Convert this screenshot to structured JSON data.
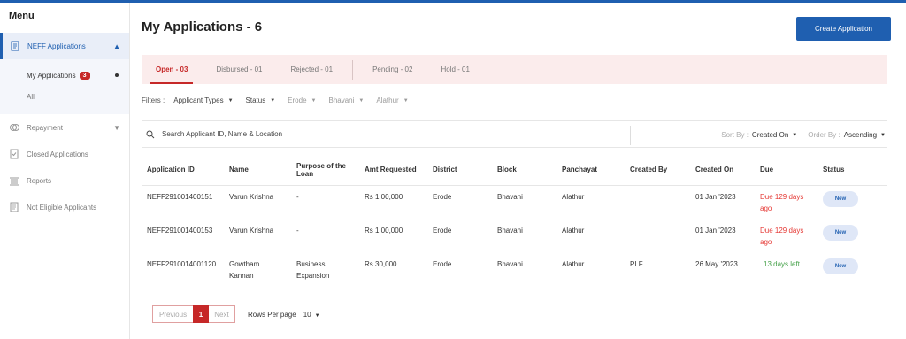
{
  "sidebar": {
    "menu_title": "Menu",
    "main_item": {
      "label": "NEFF Applications",
      "icon": "document-icon"
    },
    "sub_items": [
      {
        "label": "My Applications",
        "badge": "3"
      },
      {
        "label": "All"
      }
    ],
    "items": [
      {
        "label": "Repayment",
        "icon": "repayment-icon"
      },
      {
        "label": "Closed Applications",
        "icon": "checklist-icon"
      },
      {
        "label": "Reports",
        "icon": "bank-icon"
      },
      {
        "label": "Not Eligible Applicants",
        "icon": "document-icon"
      }
    ]
  },
  "header": {
    "title": "My Applications - 6",
    "create_button": "Create Application"
  },
  "tabs": [
    {
      "label": "Open - 03"
    },
    {
      "label": "Disbursed - 01"
    },
    {
      "label": "Rejected - 01"
    },
    {
      "label": "Pending - 02"
    },
    {
      "label": "Hold - 01"
    }
  ],
  "filters": {
    "label": "Filters :",
    "items": [
      {
        "label": "Applicant Types"
      },
      {
        "label": "Status"
      },
      {
        "label": "Erode"
      },
      {
        "label": "Bhavani"
      },
      {
        "label": "Alathur"
      }
    ]
  },
  "search": {
    "placeholder": "Search Applicant ID, Name & Location"
  },
  "sort": {
    "sort_by_label": "Sort By :",
    "sort_by_value": "Created On",
    "order_by_label": "Order By :",
    "order_by_value": "Ascending"
  },
  "table": {
    "headers": [
      "Application ID",
      "Name",
      "Purpose of the Loan",
      "Amt Requested",
      "District",
      "Block",
      "Panchayat",
      "Created By",
      "Created On",
      "Due",
      "Status"
    ],
    "rows": [
      {
        "id": "NEFF291001400151",
        "name": "Varun Krishna",
        "purpose": "-",
        "amount": "Rs 1,00,000",
        "district": "Erode",
        "block": "Bhavani",
        "panchayat": "Alathur",
        "created_by": "",
        "created_on": "01 Jan '2023",
        "due": "Due 129 days ago",
        "status": "New"
      },
      {
        "id": "NEFF291001400153",
        "name": "Varun Krishna",
        "purpose": "-",
        "amount": "Rs 1,00,000",
        "district": "Erode",
        "block": "Bhavani",
        "panchayat": "Alathur",
        "created_by": "",
        "created_on": "01 Jan '2023",
        "due": "Due 129 days ago",
        "status": "New"
      },
      {
        "id": "NEFF2910014001120",
        "name": "Gowtham Kannan",
        "purpose": "Business Expansion",
        "amount": "Rs 30,000",
        "district": "Erode",
        "block": "Bhavani",
        "panchayat": "Alathur",
        "created_by": "PLF",
        "created_on": "26 May '2023",
        "due": "13 days left",
        "status": "New"
      }
    ]
  },
  "pagination": {
    "previous": "Previous",
    "current": "1",
    "next": "Next",
    "rows_label": "Rows Per page",
    "rows_value": "10"
  },
  "colors": {
    "primary": "#1f5fb0",
    "accent_red": "#c62828",
    "due_red": "#e53935",
    "due_green": "#43a047"
  }
}
